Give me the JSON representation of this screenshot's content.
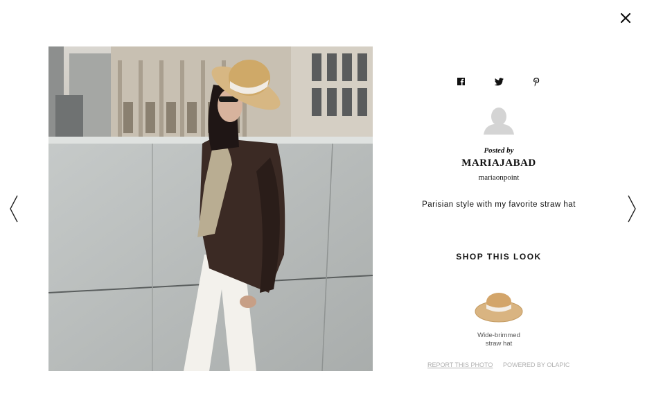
{
  "post": {
    "posted_by": "Posted by",
    "username": "MARIAJABAD",
    "handle": "mariaonpoint",
    "caption": "Parisian style with my favorite straw hat"
  },
  "share": [
    {
      "name": "facebook-icon"
    },
    {
      "name": "twitter-icon"
    },
    {
      "name": "pinterest-icon"
    }
  ],
  "shop": {
    "title": "SHOP THIS LOOK",
    "products": [
      {
        "name": "Wide-brimmed straw hat"
      }
    ]
  },
  "footer": {
    "report": "REPORT THIS PHOTO",
    "powered": "POWERED BY OLAPIC"
  },
  "icons": {
    "close": "close-icon",
    "prev": "chevron-left-icon",
    "next": "chevron-right-icon",
    "avatar": "avatar-placeholder-icon"
  }
}
